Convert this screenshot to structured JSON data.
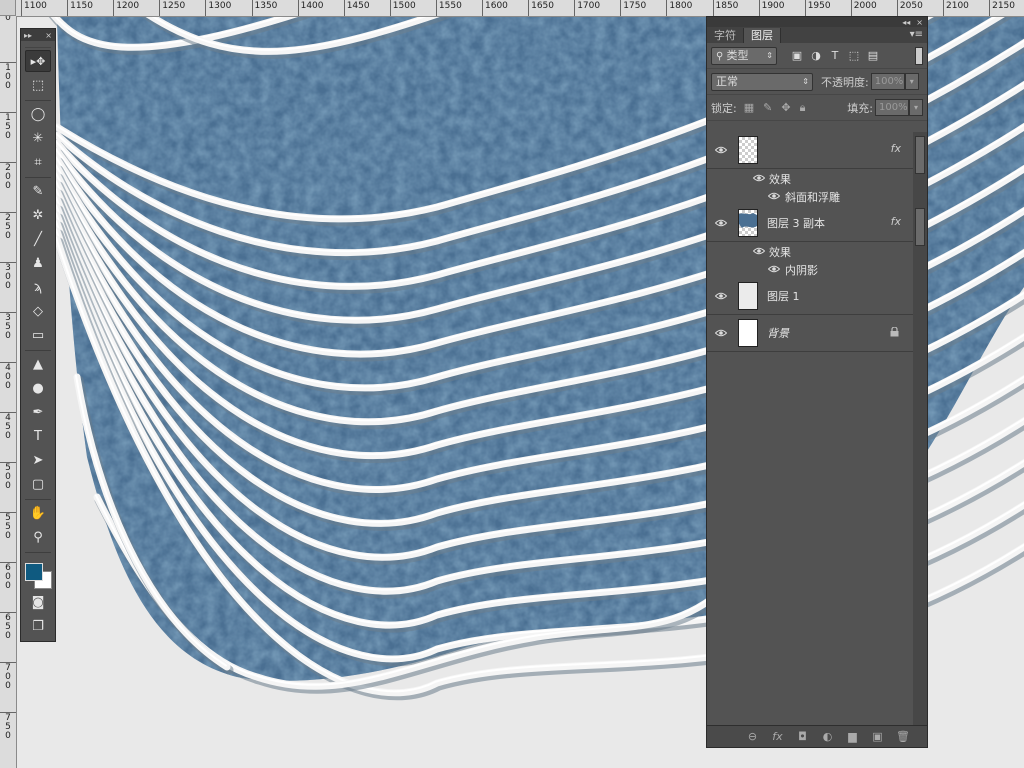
{
  "ruler_top": {
    "labels": [
      "1100",
      "1150",
      "1200",
      "1250",
      "1300",
      "1350",
      "1400",
      "1450",
      "1500",
      "1550",
      "1600",
      "1650",
      "1700",
      "1750",
      "1800",
      "1850",
      "1900",
      "1950",
      "2000",
      "2050",
      "2100",
      "2150"
    ]
  },
  "ruler_left": {
    "labels": [
      "0",
      "1\n0\n0",
      "1\n5\n0",
      "2\n0\n0",
      "2\n5\n0",
      "3\n0\n0",
      "3\n5\n0",
      "4\n0\n0",
      "4\n5\n0",
      "5\n0\n0",
      "5\n5\n0",
      "6\n0\n0",
      "6\n5\n0",
      "7\n0\n0",
      "7\n5\n0"
    ]
  },
  "tools_panel": {
    "collapse_glyph": "▸▸",
    "close_glyph": "×",
    "foreground_color": "#0f5a80",
    "background_color": "#ffffff",
    "tools": [
      {
        "id": "move",
        "icon": "move-icon",
        "glyph": "▸✥",
        "active": true
      },
      {
        "id": "marquee",
        "icon": "rect-marquee-icon",
        "glyph": "⬚"
      },
      {
        "id": "lasso",
        "icon": "lasso-icon",
        "glyph": "◯"
      },
      {
        "id": "magic",
        "icon": "magic-wand-icon",
        "glyph": "✳"
      },
      {
        "id": "crop",
        "icon": "crop-icon",
        "glyph": "⌗"
      },
      {
        "id": "eyedropper",
        "icon": "eyedropper-icon",
        "glyph": "✎"
      },
      {
        "id": "heal",
        "icon": "healing-brush-icon",
        "glyph": "✲"
      },
      {
        "id": "brush",
        "icon": "brush-icon",
        "glyph": "╱"
      },
      {
        "id": "stamp",
        "icon": "clone-stamp-icon",
        "glyph": "♟"
      },
      {
        "id": "history",
        "icon": "history-brush-icon",
        "glyph": "ϡ"
      },
      {
        "id": "eraser",
        "icon": "eraser-icon",
        "glyph": "◇"
      },
      {
        "id": "gradient",
        "icon": "gradient-icon",
        "glyph": "▭"
      },
      {
        "id": "blur",
        "icon": "blur-icon",
        "glyph": "▲"
      },
      {
        "id": "dodge",
        "icon": "dodge-icon",
        "glyph": "●"
      },
      {
        "id": "pen",
        "icon": "pen-icon",
        "glyph": "✒"
      },
      {
        "id": "type",
        "icon": "type-icon",
        "glyph": "T"
      },
      {
        "id": "path-select",
        "icon": "path-selection-icon",
        "glyph": "➤"
      },
      {
        "id": "shape",
        "icon": "rounded-rect-icon",
        "glyph": "▢"
      },
      {
        "id": "hand",
        "icon": "hand-icon",
        "glyph": "✋"
      },
      {
        "id": "zoom",
        "icon": "zoom-icon",
        "glyph": "⚲"
      }
    ],
    "bottom_tools": [
      {
        "id": "quickmask",
        "icon": "quick-mask-icon",
        "glyph": "◙"
      },
      {
        "id": "screenmode",
        "icon": "screen-mode-icon",
        "glyph": "❐"
      }
    ]
  },
  "layers_panel": {
    "tabs": [
      "字符",
      "图层"
    ],
    "active_tab": 1,
    "filter": {
      "label": "类型",
      "icons": [
        "image-filter-icon",
        "adjustment-filter-icon",
        "type-filter-icon",
        "shape-filter-icon",
        "smart-object-filter-icon"
      ],
      "glyphs": [
        "▣",
        "◑",
        "T",
        "⬚",
        "▤"
      ]
    },
    "blend_mode": "正常",
    "opacity_label": "不透明度:",
    "opacity_value": "100%",
    "lock_label": "锁定:",
    "fill_label": "填充:",
    "fill_value": "100%",
    "fx_label": "fx",
    "layers": [
      {
        "name": "",
        "thumb": "checker",
        "fx": true,
        "effects_label": "效果",
        "effects": [
          "斜面和浮雕"
        ]
      },
      {
        "name": "图层 3 副本",
        "thumb": "checker-blue",
        "fx": true,
        "effects_label": "效果",
        "effects": [
          "内阴影"
        ]
      },
      {
        "name": "图层 1",
        "thumb": "light",
        "fx": false
      },
      {
        "name": "背景",
        "thumb": "white",
        "fx": false,
        "locked": true
      }
    ],
    "footer_icons": [
      "link-icon",
      "fx-icon",
      "mask-icon",
      "adjustment-icon",
      "folder-icon",
      "new-layer-icon",
      "trash-icon"
    ],
    "footer_glyphs": [
      "⊖",
      "fx",
      "◘",
      "◐",
      "▆",
      "▣",
      "🗑"
    ]
  }
}
